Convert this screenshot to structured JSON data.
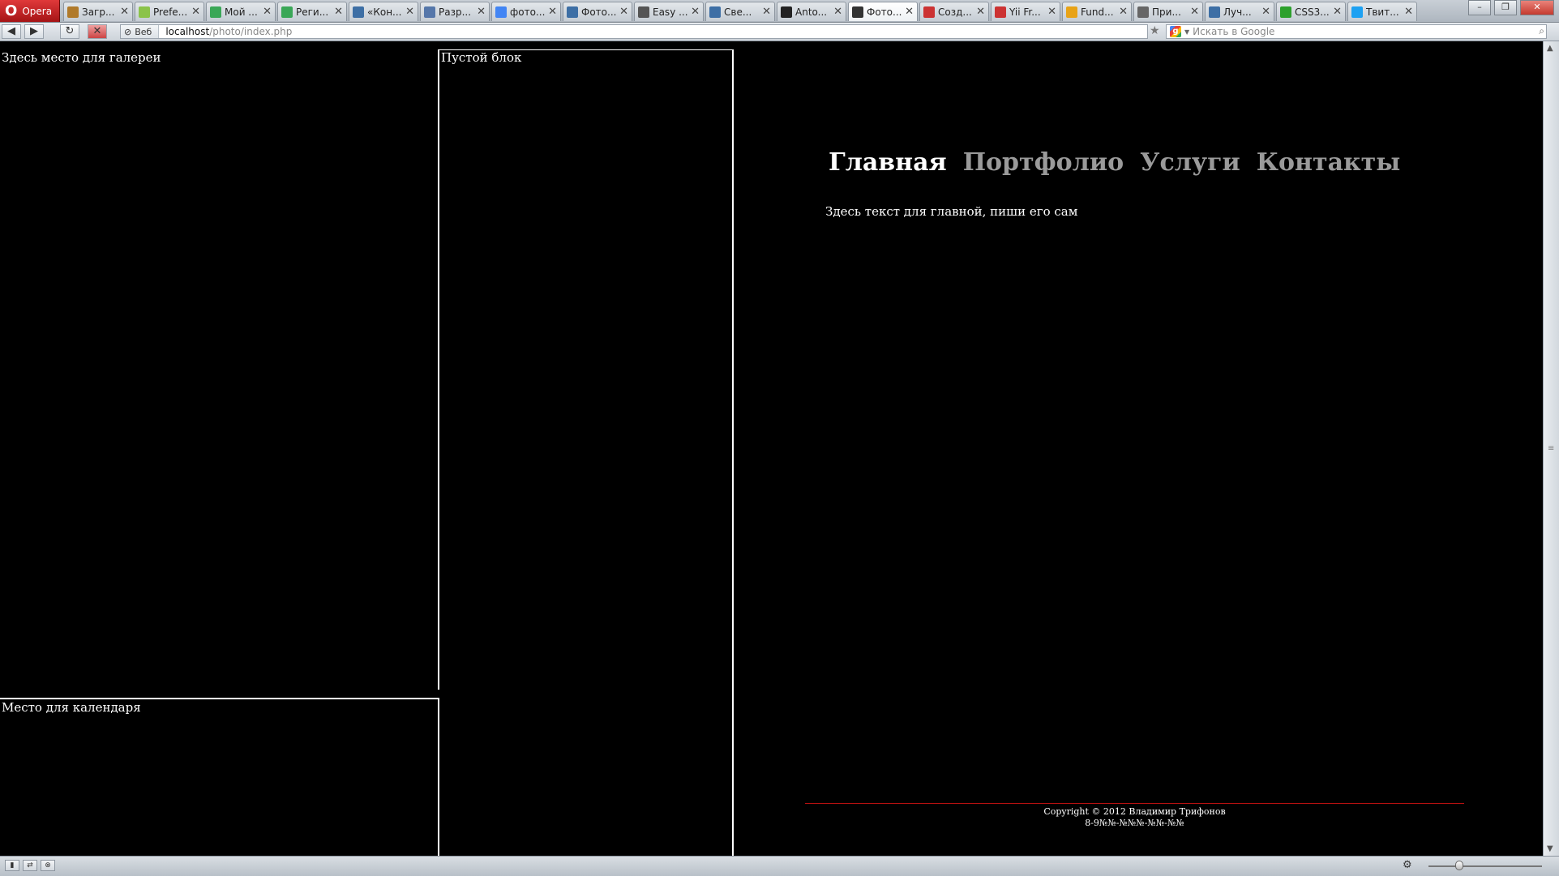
{
  "browser": {
    "menu_label": "Opera",
    "tabs": [
      {
        "title": "Загр...",
        "icon": "download-icon",
        "color": "#b07a2a"
      },
      {
        "title": "Prefe...",
        "icon": "android-icon",
        "color": "#8bc34a"
      },
      {
        "title": "Мой ...",
        "icon": "play-store-icon",
        "color": "#3aa757"
      },
      {
        "title": "Реги...",
        "icon": "play-store-icon",
        "color": "#3aa757"
      },
      {
        "title": "«Кон...",
        "icon": "habr-icon",
        "color": "#3d6fa5"
      },
      {
        "title": "Разр...",
        "icon": "feather-icon",
        "color": "#5577aa"
      },
      {
        "title": "фото...",
        "icon": "google-icon",
        "color": "#4285f4"
      },
      {
        "title": "Фото...",
        "icon": "habr-icon",
        "color": "#3d6fa5"
      },
      {
        "title": "Easy ...",
        "icon": "globe-icon",
        "color": "#555555"
      },
      {
        "title": "Све...",
        "icon": "habr-icon",
        "color": "#3d6fa5"
      },
      {
        "title": "Anto...",
        "icon": "letter-a-icon",
        "color": "#222222"
      },
      {
        "title": "Фото...",
        "icon": "spy-icon",
        "color": "#333333",
        "active": true
      },
      {
        "title": "Созд...",
        "icon": "doc-icon",
        "color": "#cc3333"
      },
      {
        "title": "Yii Fr...",
        "icon": "yii-icon",
        "color": "#cc3333"
      },
      {
        "title": "Fund...",
        "icon": "pinwheel-icon",
        "color": "#e8a317"
      },
      {
        "title": "При...",
        "icon": "page-icon",
        "color": "#666666"
      },
      {
        "title": "Луч...",
        "icon": "habr-icon",
        "color": "#3d6fa5"
      },
      {
        "title": "CSS3...",
        "icon": "css-icon",
        "color": "#2ca02c"
      },
      {
        "title": "Твит...",
        "icon": "twitter-icon",
        "color": "#1da1f2"
      }
    ],
    "address": {
      "badge": "Веб",
      "host": "localhost",
      "path": "/photo/index.php"
    },
    "search_placeholder": "Искать в Google"
  },
  "page": {
    "gallery_label": "Здесь место для галереи",
    "empty_label": "Пустой блок",
    "calendar_label": "Место для календаря",
    "nav": {
      "home": "Главная",
      "portfolio": "Портфолио",
      "services": "Услуги",
      "contacts": "Контакты"
    },
    "main_text": "Здесь текст для главной, пиши его сам",
    "footer": {
      "copyright": "Copyright © 2012 Владимир Трифонов",
      "phone": "8-9№№-№№№-№№-№№"
    }
  },
  "colors": {
    "background": "#000000",
    "nav_inactive": "#9a9a9a",
    "footer_rule": "#b51010"
  }
}
